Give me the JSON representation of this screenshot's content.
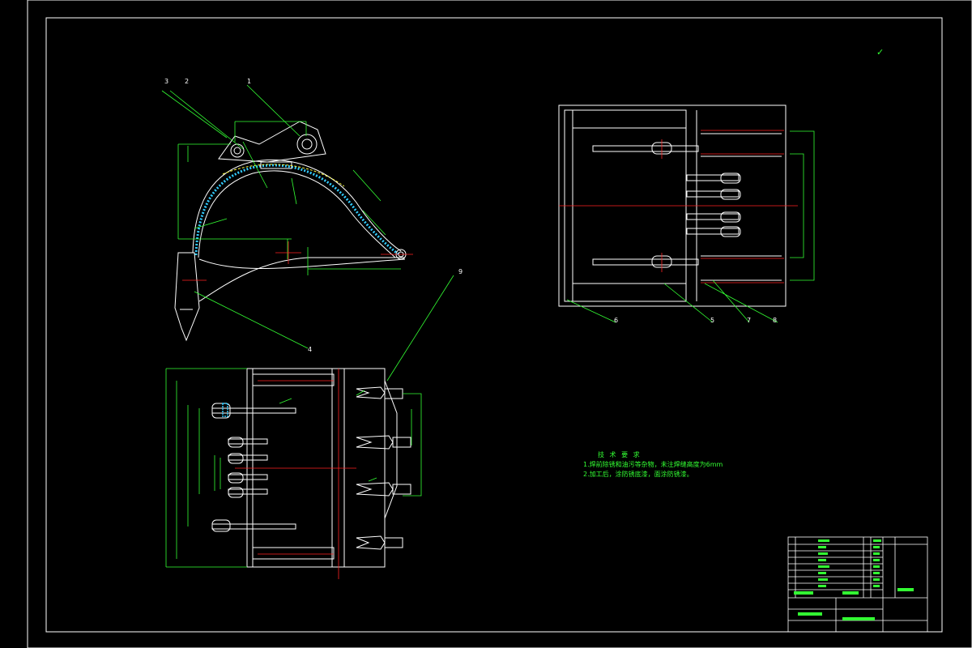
{
  "drawing": {
    "callouts": [
      "3",
      "2",
      "1",
      "4",
      "9",
      "6",
      "5",
      "7",
      "8"
    ],
    "technical_requirements": {
      "title": "技 术 要 求",
      "lines": [
        "1.焊前除锈和油污等杂物，未注焊缝高度为6mm",
        "2.加工后，涂防锈底漆，面涂防锈漆。"
      ]
    },
    "roughness_mark": "✓"
  },
  "colors": {
    "background": "#000000",
    "outline": "#ffffff",
    "dimension": "#33ff33",
    "centerline": "#ff2222",
    "weld": "#33ccff",
    "hidden": "#ffff44"
  }
}
